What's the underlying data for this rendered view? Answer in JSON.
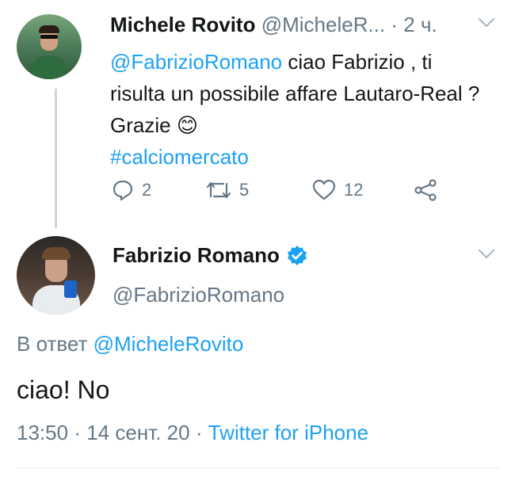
{
  "tweet1": {
    "author_name": "Michele Rovito",
    "author_handle": "@MicheleR...",
    "time_sep": "·",
    "time": "2 ч.",
    "mention": "@FabrizioRomano",
    "text_part1": " ciao Fabrizio , ti risulta un possibile affare Lautaro-Real ? Grazie ",
    "emoji": "😊",
    "hashtag": "#calciomercato",
    "replies": "2",
    "retweets": "5",
    "likes": "12"
  },
  "tweet2": {
    "author_name": "Fabrizio Romano",
    "verified": true,
    "author_handle": "@FabrizioRomano",
    "reply_prefix": "В ответ",
    "reply_to": "@MicheleRovito",
    "text": "ciao! No",
    "time": "13:50",
    "date": "14 сент. 20",
    "source": "Twitter for iPhone",
    "sep": "·"
  },
  "colors": {
    "link": "#1da1f2",
    "muted": "#657786",
    "text": "#14171a",
    "verified": "#1da1f2"
  },
  "icons": [
    "reply-icon",
    "retweet-icon",
    "like-icon",
    "share-icon",
    "chevron-down-icon",
    "verified-badge-icon"
  ]
}
